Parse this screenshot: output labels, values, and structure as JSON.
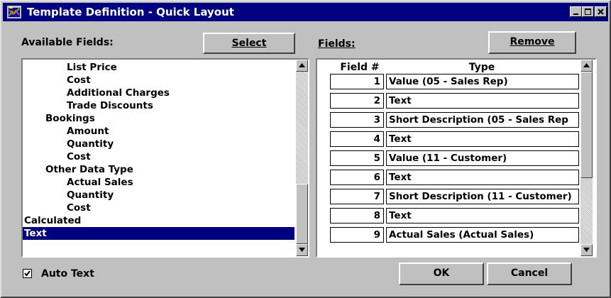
{
  "window": {
    "title": "Template Definition - Quick Layout"
  },
  "available_fields": {
    "label": "Available Fields:",
    "select_button": "Select",
    "items": [
      {
        "text": "List Price",
        "level": 2
      },
      {
        "text": "Cost",
        "level": 2
      },
      {
        "text": "Additional Charges",
        "level": 2
      },
      {
        "text": "Trade Discounts",
        "level": 2
      },
      {
        "text": "Bookings",
        "level": 1
      },
      {
        "text": "Amount",
        "level": 2
      },
      {
        "text": "Quantity",
        "level": 2
      },
      {
        "text": "Cost",
        "level": 2
      },
      {
        "text": "Other Data Type",
        "level": 1
      },
      {
        "text": "Actual Sales",
        "level": 2
      },
      {
        "text": "Quantity",
        "level": 2
      },
      {
        "text": "Cost",
        "level": 2
      },
      {
        "text": "Calculated",
        "level": 0
      },
      {
        "text": "Text",
        "level": 0,
        "selected": true
      }
    ]
  },
  "fields": {
    "label": "Fields:",
    "remove_button": "Remove",
    "columns": [
      "Field #",
      "Type"
    ],
    "rows": [
      {
        "num": "1",
        "type": "Value (05 - Sales Rep)"
      },
      {
        "num": "2",
        "type": "Text"
      },
      {
        "num": "3",
        "type": "Short Description (05 - Sales Rep"
      },
      {
        "num": "4",
        "type": "Text"
      },
      {
        "num": "5",
        "type": "Value (11 - Customer)"
      },
      {
        "num": "6",
        "type": "Text"
      },
      {
        "num": "7",
        "type": "Short Description (11 - Customer)"
      },
      {
        "num": "8",
        "type": "Text"
      },
      {
        "num": "9",
        "type": "Actual Sales (Actual Sales)"
      }
    ]
  },
  "footer": {
    "auto_text_label": "Auto Text",
    "auto_text_checked": true,
    "ok_button": "OK",
    "cancel_button": "Cancel"
  },
  "colors": {
    "titlebar": "#000080",
    "face": "#c0c0c0",
    "selection": "#000080"
  },
  "icons": [
    "app-icon",
    "minimize-icon",
    "maximize-icon",
    "close-icon",
    "scroll-up-arrow-icon",
    "scroll-down-arrow-icon",
    "checkmark-icon"
  ]
}
